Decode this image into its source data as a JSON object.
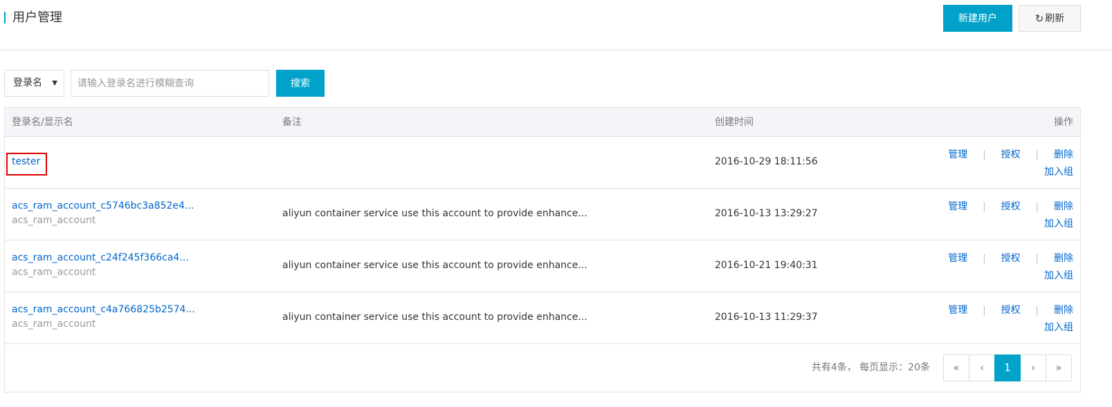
{
  "header": {
    "title": "用户管理",
    "new_user_label": "新建用户",
    "refresh_label": "刷新"
  },
  "search": {
    "select_value": "登录名",
    "placeholder": "请输入登录名进行模糊查询",
    "button_label": "搜索"
  },
  "table": {
    "columns": [
      "登录名/显示名",
      "备注",
      "创建时间",
      "操作"
    ],
    "rows": [
      {
        "login_name": "tester",
        "display_name": "",
        "remark": "",
        "created": "2016-10-29 18:11:56",
        "highlighted": true
      },
      {
        "login_name": "acs_ram_account_c5746bc3a852e4...",
        "display_name": "acs_ram_account",
        "remark": "aliyun container service use this account to provide enhance...",
        "created": "2016-10-13 13:29:27"
      },
      {
        "login_name": "acs_ram_account_c24f245f366ca4...",
        "display_name": "acs_ram_account",
        "remark": "aliyun container service use this account to provide enhance...",
        "created": "2016-10-21 19:40:31"
      },
      {
        "login_name": "acs_ram_account_c4a766825b2574...",
        "display_name": "acs_ram_account",
        "remark": "aliyun container service use this account to provide enhance...",
        "created": "2016-10-13 11:29:37"
      }
    ],
    "actions": {
      "manage": "管理",
      "authorize": "授权",
      "delete": "删除",
      "add_to_group": "加入组",
      "separator": "|"
    }
  },
  "pagination": {
    "info": "共有4条， 每页显示：20条",
    "first": "«",
    "prev": "‹",
    "current": "1",
    "next": "›",
    "last": "»"
  },
  "colors": {
    "accent": "#00a2ca",
    "link": "#0066cc",
    "highlight_border": "#e00000"
  }
}
